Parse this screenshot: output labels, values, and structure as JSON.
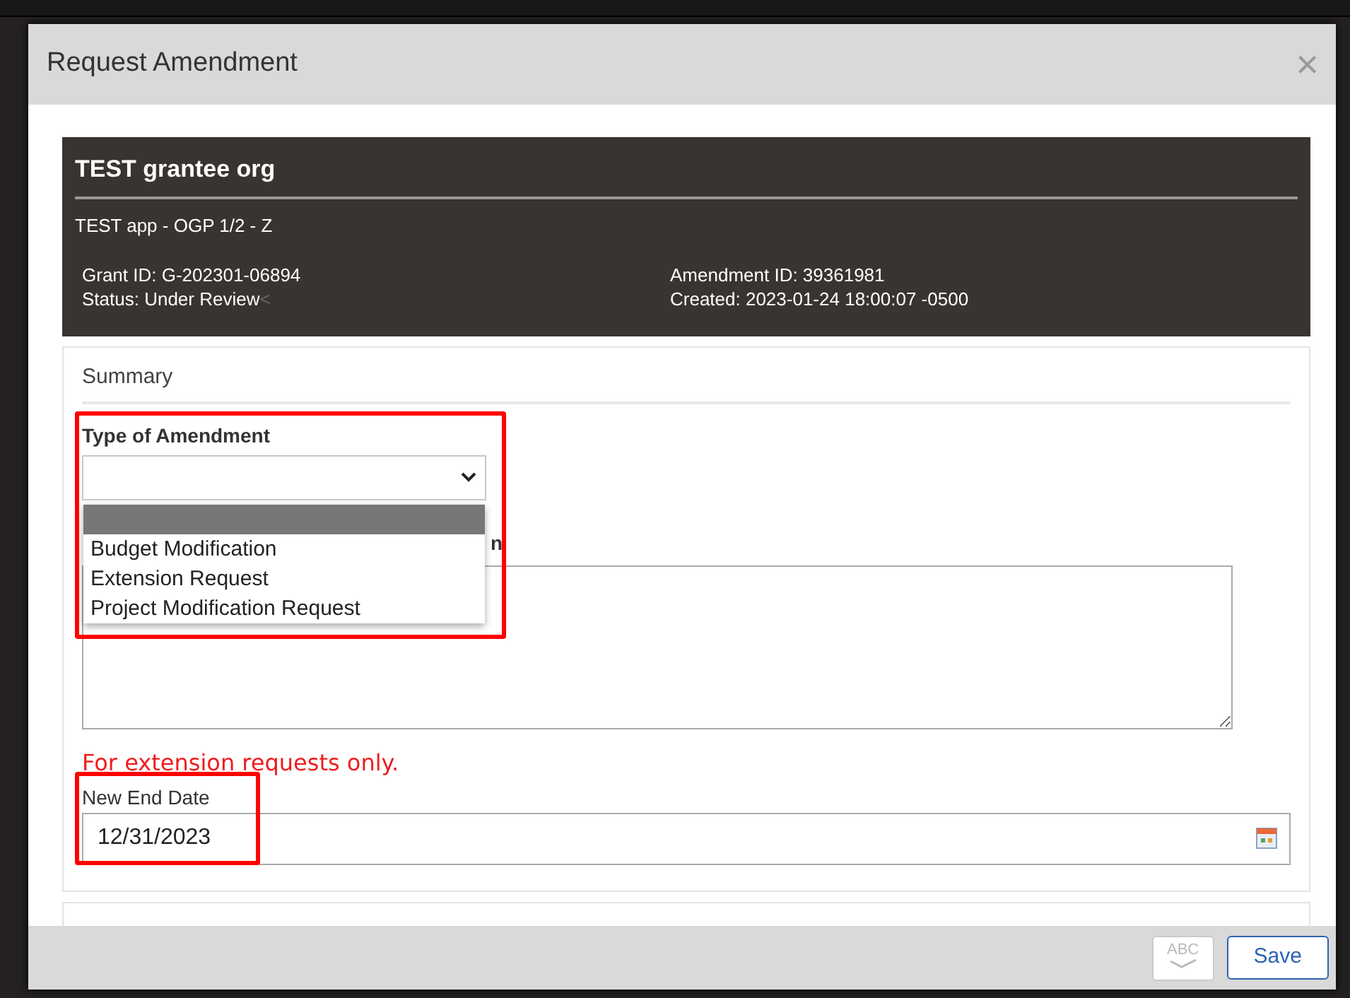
{
  "dialog": {
    "title": "Request Amendment",
    "close": "×"
  },
  "header": {
    "organization": "TEST grantee org",
    "application": "TEST app - OGP 1/2 - Z",
    "grant_id": "Grant ID: G-202301-06894",
    "status": "Status: Under Review",
    "status_mark": "<",
    "amendment_id": "Amendment ID: 39361981",
    "created": "Created: 2023-01-24 18:00:07 -0500"
  },
  "summary": {
    "heading": "Summary",
    "type_field": {
      "label": "Type of Amendment",
      "highlighted": true,
      "expanded": true,
      "options": [
        {
          "selected": true
        },
        {
          "label": "Budget Modification",
          "selected": false
        },
        {
          "label": "Extension Request",
          "selected": false
        },
        {
          "label": "Project Modification Request",
          "selected": false
        }
      ]
    },
    "description_label": "n",
    "note": "For extension requests only.",
    "date_field": {
      "label": "New End Date",
      "value": "12/31/2023",
      "highlighted": true
    }
  },
  "footer": {
    "spellcheck": "ABC",
    "save": "Save"
  }
}
